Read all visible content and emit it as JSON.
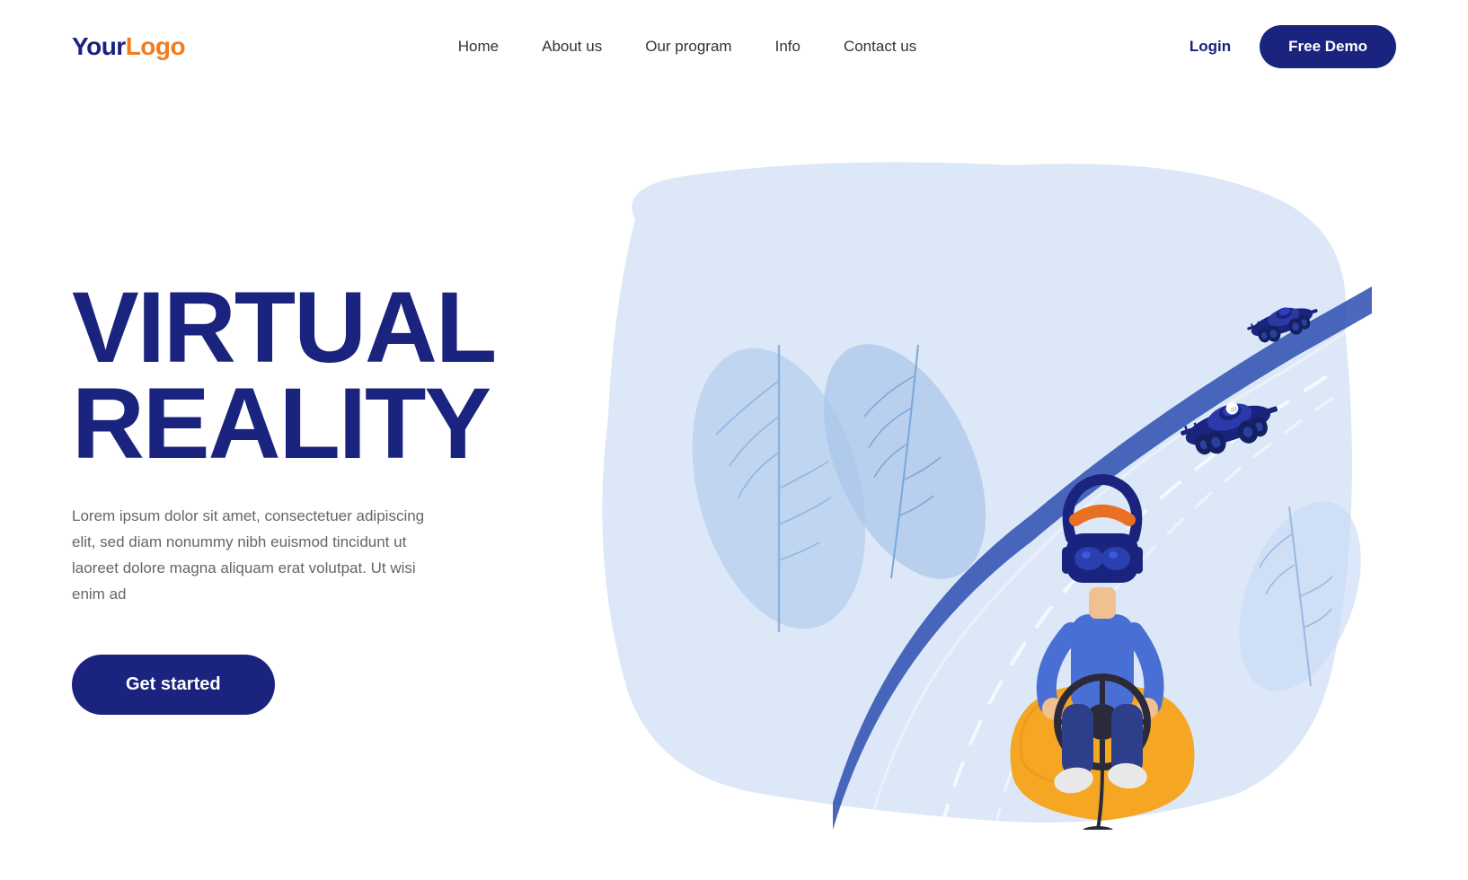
{
  "logo": {
    "your": "Your",
    "logo": "Logo"
  },
  "nav": {
    "links": [
      {
        "label": "Home",
        "id": "home"
      },
      {
        "label": "About us",
        "id": "about"
      },
      {
        "label": "Our program",
        "id": "program"
      },
      {
        "label": "Info",
        "id": "info"
      },
      {
        "label": "Contact us",
        "id": "contact"
      }
    ]
  },
  "actions": {
    "login": "Login",
    "free_demo": "Free Demo"
  },
  "hero": {
    "title_line1": "VIRTUAL",
    "title_line2": "REALITY",
    "description": "Lorem ipsum dolor sit amet, consectetuer adipiscing elit, sed diam nonummy nibh euismod tincidunt ut laoreet dolore magna aliquam erat volutpat. Ut wisi enim ad",
    "cta": "Get started"
  },
  "colors": {
    "navy": "#1a237e",
    "orange": "#f47c20",
    "light_blue": "#c5d8f5",
    "mid_blue": "#3d5afe",
    "bg_blue": "#dce8f8"
  }
}
